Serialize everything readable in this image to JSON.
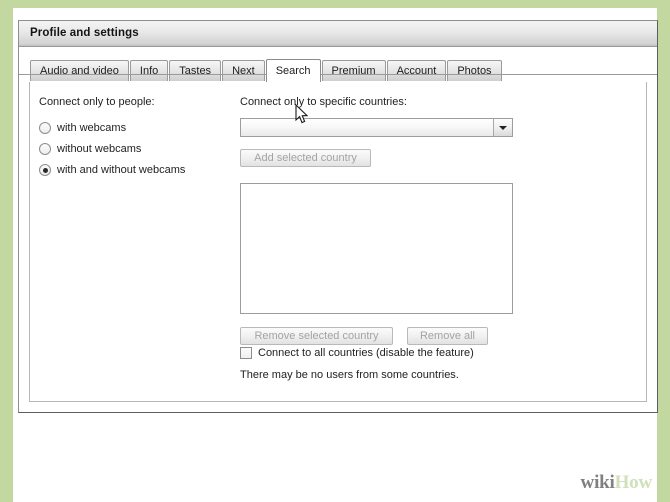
{
  "window": {
    "title": "Profile and settings"
  },
  "tabs": [
    {
      "label": "Audio and video",
      "active": false
    },
    {
      "label": "Info",
      "active": false
    },
    {
      "label": "Tastes",
      "active": false
    },
    {
      "label": "Next",
      "active": false
    },
    {
      "label": "Search",
      "active": true
    },
    {
      "label": "Premium",
      "active": false
    },
    {
      "label": "Account",
      "active": false
    },
    {
      "label": "Photos",
      "active": false
    }
  ],
  "left_panel": {
    "heading": "Connect only to people:",
    "options": [
      {
        "label": "with webcams",
        "selected": false
      },
      {
        "label": "without webcams",
        "selected": false
      },
      {
        "label": "with and without webcams",
        "selected": true
      }
    ]
  },
  "right_panel": {
    "heading": "Connect only to specific countries:",
    "country_select": {
      "value": "",
      "placeholder": ""
    },
    "add_button": {
      "label": "Add selected country",
      "disabled": true
    },
    "selected_countries": [],
    "remove_selected_button": {
      "label": "Remove selected country",
      "disabled": true
    },
    "remove_all_button": {
      "label": "Remove all",
      "disabled": true
    },
    "all_countries_checkbox": {
      "label": "Connect to all countries (disable the feature)",
      "checked": false
    },
    "hint": "There may be no users from some countries."
  },
  "watermark": {
    "part1": "wiki",
    "part2": "How"
  },
  "colors": {
    "page_border": "#c3d8a1",
    "titlebar_top": "#f3f3f3",
    "titlebar_bottom": "#bdbdbd",
    "tab_active_bg": "#ffffff",
    "disabled_text": "#a3a3a3",
    "watermark_green": "#c8dbae"
  }
}
